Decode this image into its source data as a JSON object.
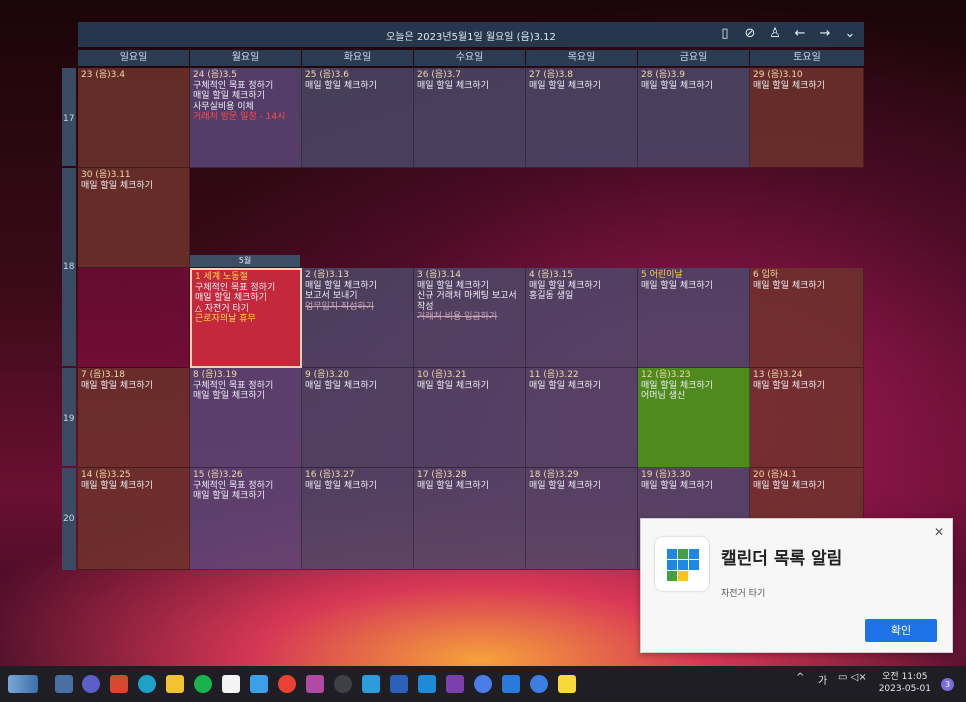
{
  "header": {
    "title": "오늘은 2023년5월1일 월요일 (음)3.12"
  },
  "weekdays": [
    "일요일",
    "월요일",
    "화요일",
    "수요일",
    "목요일",
    "금요일",
    "토요일"
  ],
  "week_numbers": [
    "17",
    "18",
    "19",
    "20"
  ],
  "month_tag": "5월",
  "cells": {
    "w17": [
      {
        "date": "23 (음)3.4",
        "items": []
      },
      {
        "date": "24 (음)3.5",
        "items": [
          "구체적인 목표 정하기",
          "매일 할일 체크하기",
          "사무실비용 이체"
        ],
        "red": "거래처 방문 일정 - 14시"
      },
      {
        "date": "25 (음)3.6",
        "items": [
          "매일 할일 체크하기"
        ]
      },
      {
        "date": "26 (음)3.7",
        "items": [
          "매일 할일 체크하기"
        ]
      },
      {
        "date": "27 (음)3.8",
        "items": [
          "매일 할일 체크하기"
        ]
      },
      {
        "date": "28 (음)3.9",
        "items": [
          "매일 할일 체크하기"
        ]
      },
      {
        "date": "29 (음)3.10",
        "items": [
          "매일 할일 체크하기"
        ]
      }
    ],
    "w18a": {
      "date": "30 (음)3.11",
      "items": [
        "매일 할일 체크하기"
      ]
    },
    "w18": [
      {
        "date": "",
        "items": []
      },
      {
        "date": "1 세계 노동절",
        "items": [
          "구체적인 목표 정하기",
          "매일 할일 체크하기",
          "△ 자전거 타기"
        ],
        "yellow": "근로자의날 휴무"
      },
      {
        "date": "2 (음)3.13",
        "items": [
          "매일 할일 체크하기",
          "보고서 보내기"
        ],
        "strike": "업무일지 작성하기"
      },
      {
        "date": "3 (음)3.14",
        "items": [
          "매일 할일 체크하기",
          "신규 거래처 마케팅 보고서",
          "작성"
        ],
        "strike": "거래처 비용 입금하기"
      },
      {
        "date": "4 (음)3.15",
        "items": [
          "매일 할일 체크하기",
          "홍길동 생일"
        ]
      },
      {
        "date": "5 어린이날",
        "items": [
          "매일 할일 체크하기"
        ]
      },
      {
        "date": "6 입하",
        "items": [
          "매일 할일 체크하기"
        ]
      }
    ],
    "w19": [
      {
        "date": "7 (음)3.18",
        "items": [
          "매일 할일 체크하기"
        ]
      },
      {
        "date": "8 (음)3.19",
        "items": [
          "구체적인 목표 정하기",
          "매일 할일 체크하기"
        ]
      },
      {
        "date": "9 (음)3.20",
        "items": [
          "매일 할일 체크하기"
        ]
      },
      {
        "date": "10 (음)3.21",
        "items": [
          "매일 할일 체크하기"
        ]
      },
      {
        "date": "11 (음)3.22",
        "items": [
          "매일 할일 체크하기"
        ]
      },
      {
        "date": "12 (음)3.23",
        "items": [
          "매일 할일 체크하기",
          "어머님 생신"
        ]
      },
      {
        "date": "13 (음)3.24",
        "items": [
          "매일 할일 체크하기"
        ]
      }
    ],
    "w20": [
      {
        "date": "14 (음)3.25",
        "items": [
          "매일 할일 체크하기"
        ]
      },
      {
        "date": "15 (음)3.26",
        "items": [
          "구체적인 목표 정하기",
          "매일 할일 체크하기"
        ]
      },
      {
        "date": "16 (음)3.27",
        "items": [
          "매일 할일 체크하기"
        ]
      },
      {
        "date": "17 (음)3.28",
        "items": [
          "매일 할일 체크하기"
        ]
      },
      {
        "date": "18 (음)3.29",
        "items": [
          "매일 할일 체크하기"
        ]
      },
      {
        "date": "19 (음)3.30",
        "items": [
          "매일 할일 체크하기"
        ]
      },
      {
        "date": "20 (음)4.1",
        "items": [
          "매일 할일 체크하기"
        ]
      }
    ]
  },
  "notification": {
    "title": "캘린더 목록 알림",
    "body": "자전거 타기",
    "button": "확인"
  },
  "tray": {
    "ime": "가",
    "time": "오전 11:05",
    "date": "2023-05-01",
    "badge": "3"
  },
  "colors": {
    "accent": "#1e73e8",
    "today_red": "#c4283c",
    "friday_green": "#4f8a1e"
  }
}
